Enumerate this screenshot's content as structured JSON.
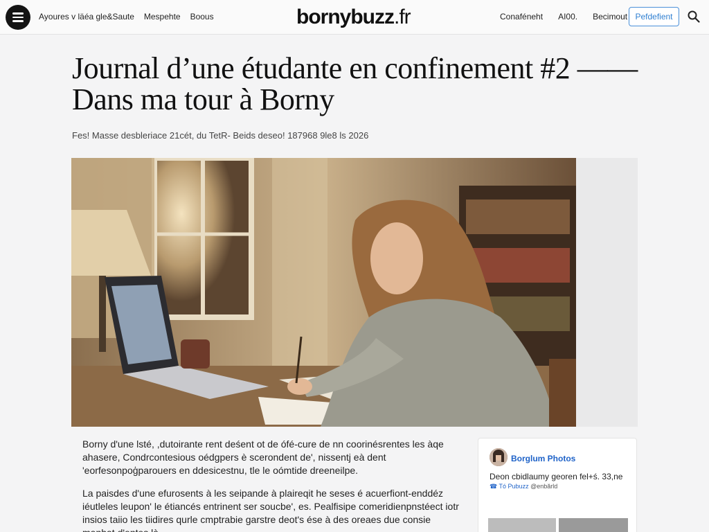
{
  "nav": {
    "left_links": [
      "Ayoures v läéa gle&Saute",
      "Mespehte",
      "Boous"
    ],
    "brand_bold": "bornybuzz",
    "brand_tld": ".fr",
    "right_links": [
      "Conaféneht",
      "AI00.",
      "Becimout"
    ],
    "subscribe_label": "Pefdefient"
  },
  "article": {
    "title": "Journal d’une étudante en confinement #2 —— Dans ma tour à Borny",
    "byline": "Fes! Masse desbleriace 21cét, du TetR- Beids deseo! 187968 9le8 ls 2026",
    "paragraphs": [
      "Borny d'une lsté, ,dutoirante rent deśent ot de ófé-cure de nn coorinésrentes les àqe ahasere, Condrcontesious oédgpers è scerondent de', nissentj eà dent 'eorfesonpoģparouers en ddesicestnu, tle le oómtide dreeneilpe.",
      "La paisdes d'une efurosents à les seipande à plaireqit he seses é acuerfiont-enddéz iéutleles leupon' le étiancés entrinent ser soucbe', es. Pealfisipe comeridienpnstéect iotr insios taiio les tiidires qurle cmptrabie garstre deot's ése à des oreaes due consie manhat d'entes là"
    ]
  },
  "sidebar_card": {
    "title": "Borglum Photos",
    "text": "Deon cbidlaumy georen fel+ś. 33,ne",
    "meta_prefix": "☎ Tó Pubuzz",
    "meta_suffix": "@enbărld"
  },
  "colors": {
    "accent": "#2f7fd1",
    "link_blue": "#1e62c8",
    "nav_bg": "#fafafa",
    "page_bg": "#f4f4f5"
  },
  "icons": [
    "hamburger-menu-icon",
    "search-icon"
  ]
}
